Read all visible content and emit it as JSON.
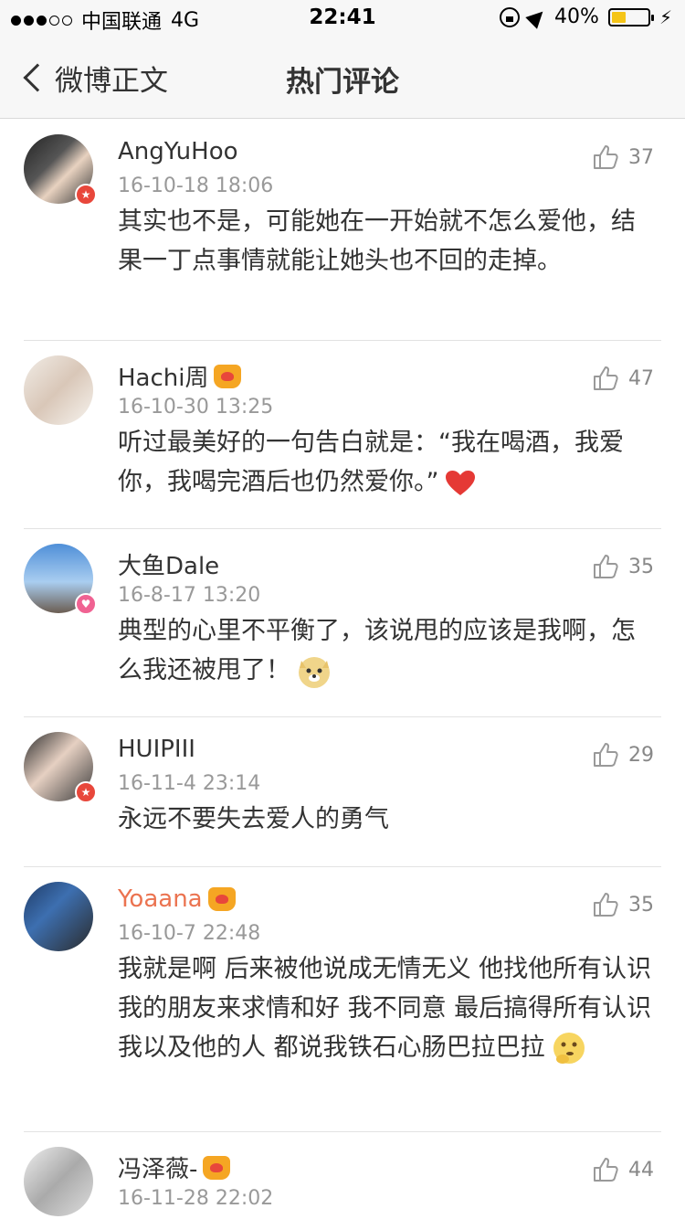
{
  "status_bar": {
    "carrier": "中国联通",
    "network": "4G",
    "time": "22:41",
    "battery": "40%",
    "battery_level": 0.4,
    "signal_bars": [
      true,
      true,
      true,
      false,
      false
    ]
  },
  "nav": {
    "back_label": "微博正文",
    "title": "热门评论"
  },
  "comments": [
    {
      "user": "AngYuHoo",
      "time": "16-10-18 18:06",
      "likes": "37",
      "text": "其实也不是，可能她在一开始就不怎么爱他，结果一丁点事情就能让她头也不回的走掉。",
      "badge": "red",
      "crown": false,
      "username_color": "default",
      "emoji": ""
    },
    {
      "user": "Hachi周",
      "time": "16-10-30 13:25",
      "likes": "47",
      "text": "听过最美好的一句告白就是：“我在喝酒，我爱你，我喝完酒后也仍然爱你。”",
      "badge": "",
      "crown": true,
      "username_color": "default",
      "emoji": "heart-emoji"
    },
    {
      "user": "大鱼Dale",
      "time": "16-8-17 13:20",
      "likes": "35",
      "text": "典型的心里不平衡了，该说甩的应该是我啊，怎么我还被甩了！",
      "badge": "pink",
      "crown": false,
      "username_color": "default",
      "emoji": "doge-emoji"
    },
    {
      "user": "HUIPIII",
      "time": "16-11-4 23:14",
      "likes": "29",
      "text": "永远不要失去爱人的勇气",
      "badge": "red",
      "crown": false,
      "username_color": "default",
      "emoji": ""
    },
    {
      "user": "Yoaana",
      "time": "16-10-7 22:48",
      "likes": "35",
      "text": "我就是啊 后来被他说成无情无义 他找他所有认识我的朋友来求情和好 我不同意 最后搞得所有认识我以及他的人 都说我铁石心肠巴拉巴拉",
      "badge": "",
      "crown": true,
      "username_color": "#eb7350",
      "emoji": "thinking-emoji"
    },
    {
      "user": "冯泽薇-",
      "time": "16-11-28 22:02",
      "likes": "44",
      "text": "",
      "badge": "",
      "crown": true,
      "username_color": "default",
      "emoji": ""
    }
  ],
  "colors": {
    "accent_orange": "#eb7350",
    "badge_red": "#e8473b",
    "badge_pink": "#f06292",
    "battery_yellow": "#f5c518"
  }
}
